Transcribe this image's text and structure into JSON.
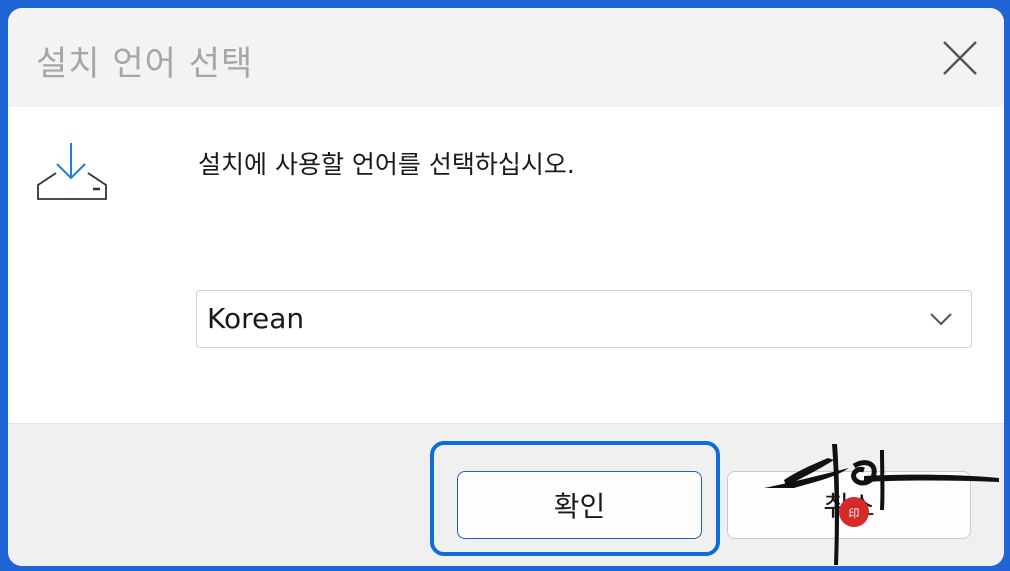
{
  "window": {
    "title": "설치 언어 선택"
  },
  "content": {
    "prompt": "설치에 사용할 언어를 선택하십시오.",
    "language_select": {
      "value": "Korean"
    }
  },
  "footer": {
    "ok_label": "확인",
    "cancel_label": "취소"
  },
  "icons": {
    "close": "close-icon",
    "install": "install-download-icon",
    "chevron": "chevron-down-icon"
  },
  "colors": {
    "accent": "#0f6cd9",
    "title_text": "#a6a6a6",
    "frame": "#1f64d6"
  }
}
